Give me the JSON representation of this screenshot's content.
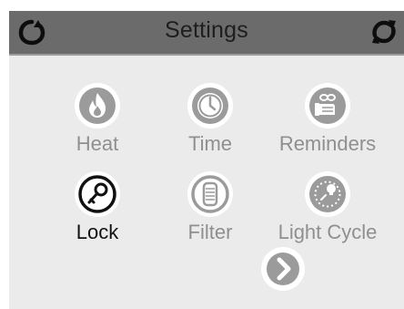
{
  "header": {
    "title": "Settings",
    "left_icon": "back-arrow-icon",
    "right_icon": "refresh-icon"
  },
  "tiles": [
    {
      "label": "Heat",
      "icon": "flame-icon",
      "active": false
    },
    {
      "label": "Time",
      "icon": "clock-icon",
      "active": false
    },
    {
      "label": "Reminders",
      "icon": "reminder-hand-icon",
      "active": false
    },
    {
      "label": "Lock",
      "icon": "key-icon",
      "active": true
    },
    {
      "label": "Filter",
      "icon": "filter-cartridge-icon",
      "active": false
    },
    {
      "label": "Light Cycle",
      "icon": "light-cycle-icon",
      "active": false
    }
  ],
  "next_button": {
    "icon": "chevron-right-icon"
  },
  "colors": {
    "header_bg": "#6b6b6b",
    "panel_bg": "#ebebeb",
    "inactive_icon": "#9b9b9b",
    "active_icon": "#111111",
    "inactive_label": "#8f8f8f",
    "active_label": "#111111"
  }
}
